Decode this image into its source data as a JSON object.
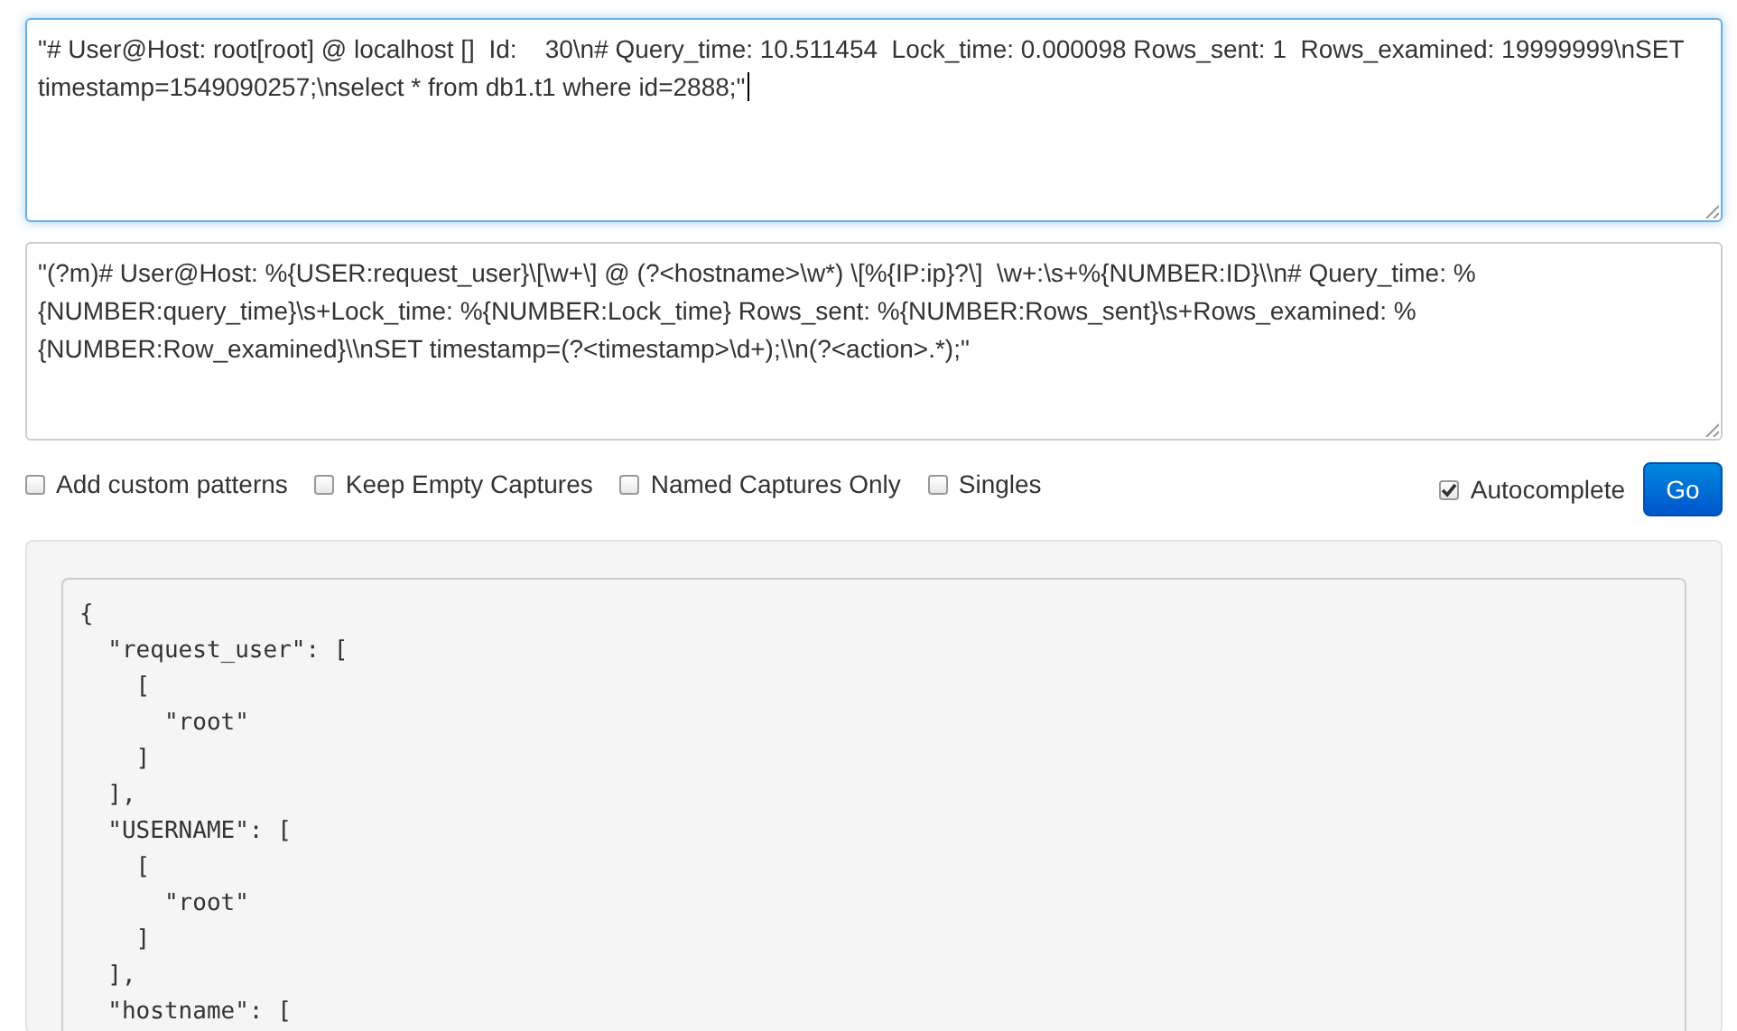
{
  "input_text": "\"# User@Host: root[root] @ localhost []  Id:    30\\n# Query_time: 10.511454  Lock_time: 0.000098 Rows_sent: 1  Rows_examined: 19999999\\nSET timestamp=1549090257;\\nselect * from db1.t1 where id=2888;\"",
  "pattern_text": "\"(?m)# User@Host: %{USER:request_user}\\[\\w+\\] @ (?<hostname>\\w*) \\[%{IP:ip}?\\]  \\w+:\\s+%{NUMBER:ID}\\\\n# Query_time: %{NUMBER:query_time}\\s+Lock_time: %{NUMBER:Lock_time} Rows_sent: %{NUMBER:Rows_sent}\\s+Rows_examined: %{NUMBER:Row_examined}\\\\nSET timestamp=(?<timestamp>\\d+);\\\\n(?<action>.*);\"",
  "options": [
    {
      "label": "Add custom patterns",
      "checked": false
    },
    {
      "label": "Keep Empty Captures",
      "checked": false
    },
    {
      "label": "Named Captures Only",
      "checked": false
    },
    {
      "label": "Singles",
      "checked": false
    }
  ],
  "autocomplete": {
    "label": "Autocomplete",
    "checked": true
  },
  "go_button": "Go",
  "output_lines": [
    "{",
    "  \"request_user\": [",
    "    [",
    "      \"root\"",
    "    ]",
    "  ],",
    "  \"USERNAME\": [",
    "    [",
    "      \"root\"",
    "    ]",
    "  ],",
    "  \"hostname\": ["
  ]
}
